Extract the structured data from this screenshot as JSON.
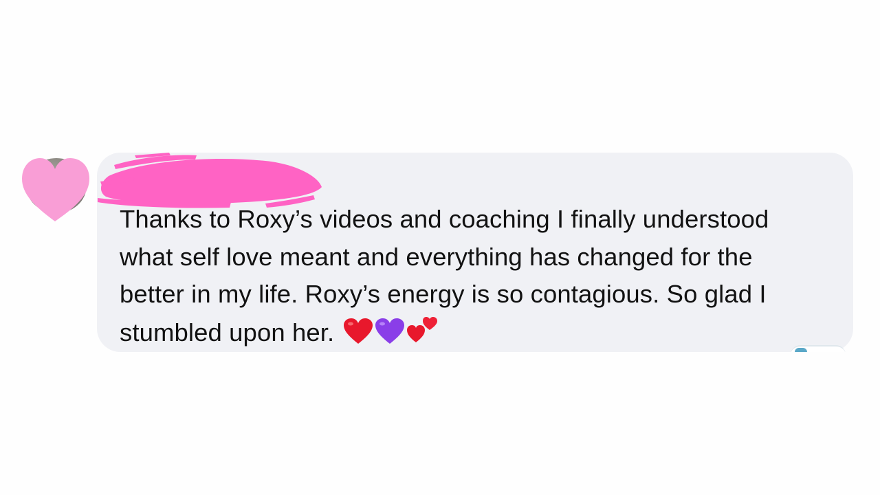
{
  "comment": {
    "text": "Thanks to Roxy’s videos and coaching I finally understood what self love meant and everything has changed for the better in my life. Roxy’s energy is so contagious. So glad I stumbled upon her.",
    "emojis": [
      "red-heart",
      "purple-heart",
      "two-hearts"
    ]
  },
  "avatar": {
    "heart_color": "#f99ed6"
  },
  "author_name_redaction": {
    "color": "#ff63c4"
  },
  "colors": {
    "bubble": "#f0f1f5",
    "text": "#121212",
    "red_heart": "#e8182c",
    "purple_heart": "#8a3ee8"
  }
}
